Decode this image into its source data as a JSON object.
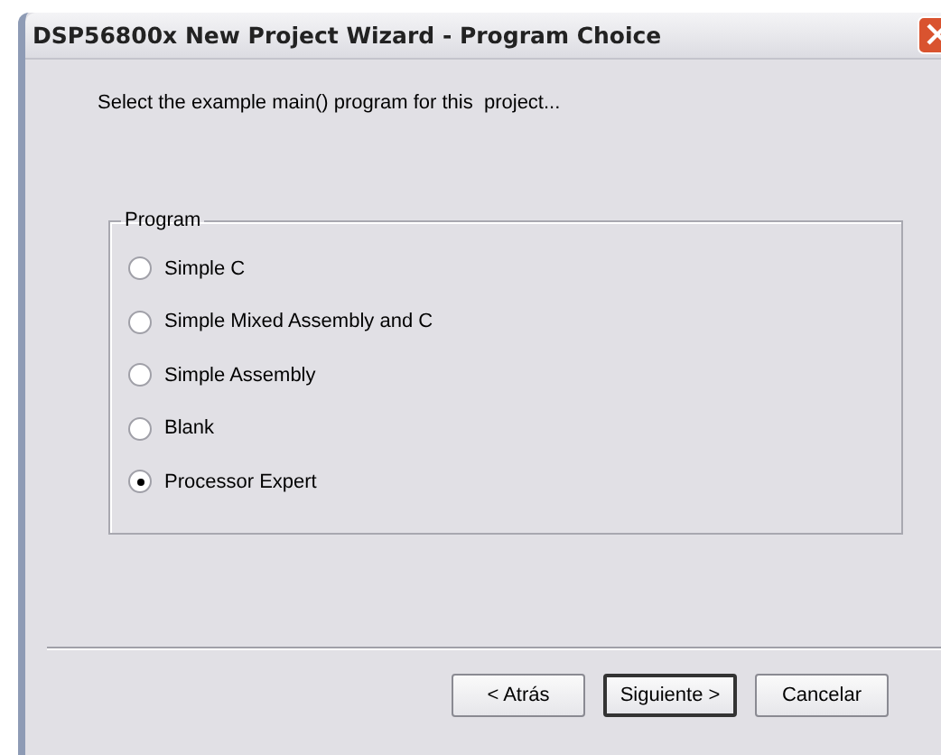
{
  "window": {
    "title": "DSP56800x New Project Wizard - Program Choice"
  },
  "prompt": "Select the example main() program for this  project...",
  "group": {
    "label": "Program",
    "options": [
      {
        "label": "Simple C",
        "selected": false
      },
      {
        "label": "Simple Mixed Assembly and C",
        "selected": false
      },
      {
        "label": "Simple Assembly",
        "selected": false
      },
      {
        "label": "Blank",
        "selected": false
      },
      {
        "label": "Processor Expert",
        "selected": true
      }
    ]
  },
  "buttons": [
    {
      "label": "< Atrás",
      "default": false
    },
    {
      "label": "Siguiente >",
      "default": true
    },
    {
      "label": "Cancelar",
      "default": false
    }
  ]
}
